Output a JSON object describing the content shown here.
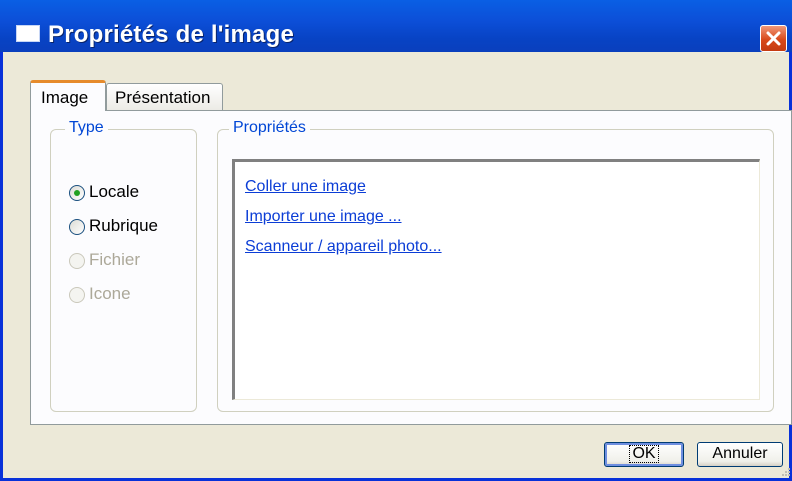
{
  "window": {
    "title": "Propriétés de l'image",
    "icon": "window-icon",
    "close_icon": "close-icon"
  },
  "tabs": [
    {
      "label": "Image",
      "active": true
    },
    {
      "label": "Présentation",
      "active": false
    }
  ],
  "type_group": {
    "legend": "Type",
    "options": [
      {
        "label": "Locale",
        "selected": true,
        "enabled": true
      },
      {
        "label": "Rubrique",
        "selected": false,
        "enabled": true
      },
      {
        "label": "Fichier",
        "selected": false,
        "enabled": false
      },
      {
        "label": "Icone",
        "selected": false,
        "enabled": false
      }
    ]
  },
  "properties_group": {
    "legend": "Propriétés",
    "links": [
      "Coller une image",
      "Importer  une image ...",
      "Scanneur / appareil photo..."
    ]
  },
  "buttons": {
    "ok": "OK",
    "cancel": "Annuler"
  },
  "colors": {
    "titlebar": "#0a5fe4",
    "active_tab_accent": "#e68b2c",
    "legend_text": "#0046d5",
    "link_text": "#0b3dd6",
    "close_button": "#d8491a",
    "radio_dot": "#21a121"
  }
}
